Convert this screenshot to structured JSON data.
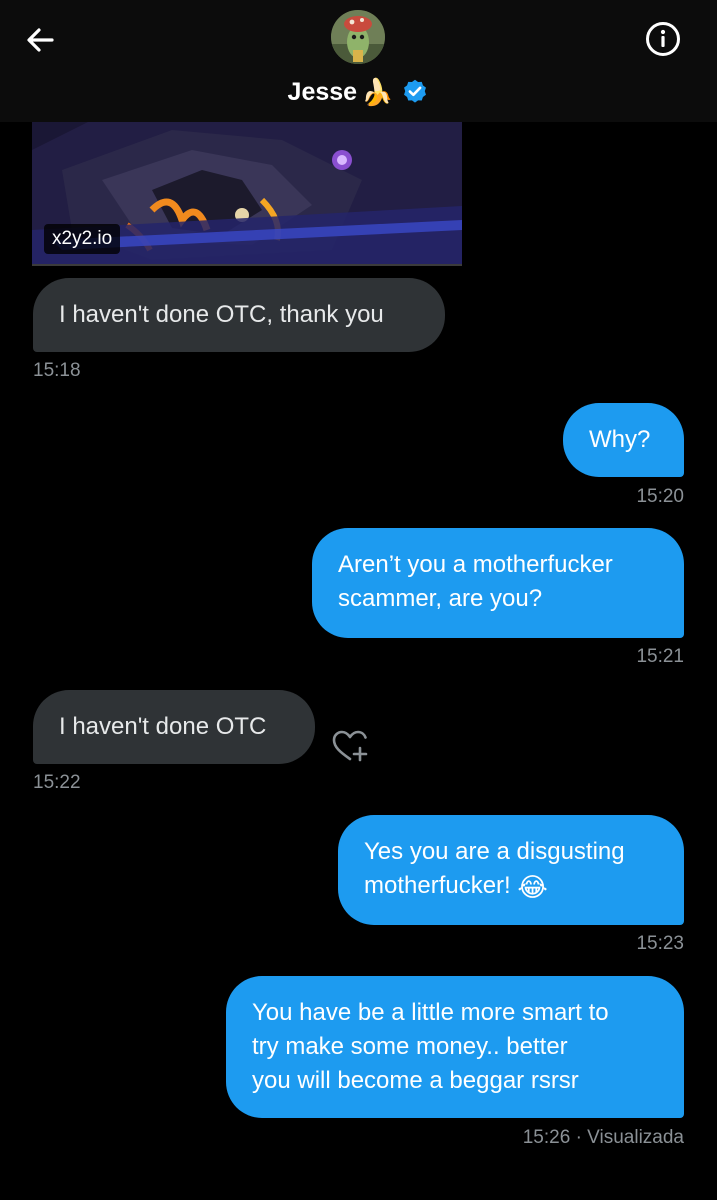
{
  "header": {
    "contact_name": "Jesse",
    "name_emoji": "🍌",
    "icons": {
      "back": "arrow-left-icon",
      "info": "info-circle-icon",
      "verified": "verified-badge-icon"
    },
    "colors": {
      "verified": "#1d9bf0",
      "background": "#0c0c0c"
    }
  },
  "link_preview": {
    "domain": "x2y2.io"
  },
  "messages": [
    {
      "direction": "incoming",
      "text": "I haven't done OTC, thank you",
      "time": "15:18"
    },
    {
      "direction": "outgoing",
      "text": "Why?",
      "time": "15:20"
    },
    {
      "direction": "outgoing",
      "lines": [
        "Aren’t you a motherfucker",
        "scammer, are you?"
      ],
      "time": "15:21"
    },
    {
      "direction": "incoming",
      "text": "I haven't done OTC",
      "time": "15:22"
    },
    {
      "direction": "outgoing",
      "lines": [
        "Yes you are a disgusting",
        "motherfucker! "
      ],
      "emoji": "😂",
      "time": "15:23"
    },
    {
      "direction": "outgoing",
      "lines": [
        "You have be a little more smart to",
        "try make some money.. better",
        "you will become a beggar rsrsr"
      ],
      "time": "15:26",
      "status": "· Visualizada"
    }
  ],
  "react_icon": "heart-plus-icon",
  "colors": {
    "outgoing_bubble": "#1d9bf0",
    "incoming_bubble": "#2f3336",
    "timestamp": "#8b9196"
  }
}
